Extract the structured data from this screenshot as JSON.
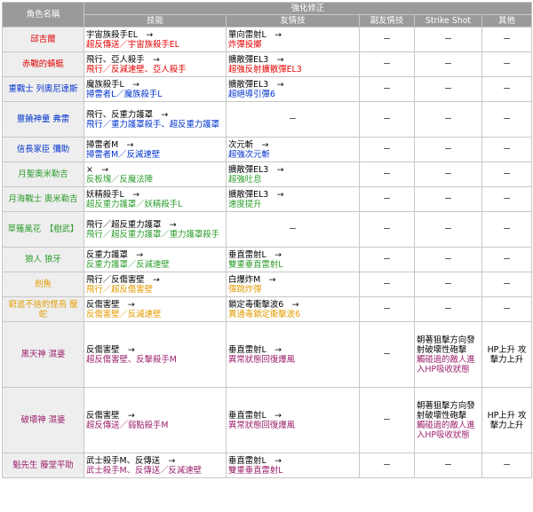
{
  "headers": {
    "name": "角色名稱",
    "group": "強化修正",
    "skill": "技能",
    "friend": "友情技",
    "subfriend": "副友情技",
    "ss": "Strike Shot",
    "other": "其他"
  },
  "dash": "－",
  "colors": {
    "red": "#e30000",
    "blue": "#0033cc",
    "green": "#2b9b2b",
    "orange": "#e39c00",
    "purple": "#9a1f6b"
  },
  "rows": [
    {
      "name": "邱吉爾",
      "skill": [
        "宇宙族殺手EL　→",
        "超反傳送／宇宙族殺手EL"
      ],
      "friend": [
        "單向雷射L　→",
        "炸彈投擲"
      ]
    },
    {
      "name": "赤戰的蜻蜓",
      "skill": [
        "飛行、亞人殺手　→",
        "飛行／反減速壁、亞人殺手"
      ],
      "friend": [
        "擴散彈EL3　→",
        "超強反射擴散彈EL3"
      ]
    },
    {
      "name": "重戰士 列奧尼達斯",
      "skill": [
        "魔族殺手L　→",
        "掃雷者L／魔族殺手L"
      ],
      "friend": [
        "擴散彈EL3　→",
        "超絕導引彈6"
      ]
    },
    {
      "name": "豐饒神童 弗雷",
      "skill": [
        "飛行、反重力護罩　→",
        "飛行／重力護罩殺手、超反重力護罩"
      ]
    },
    {
      "name": "信長家臣 彌助",
      "skill": [
        "掃雷者M　→",
        "掃雷者M／反減速壁"
      ],
      "friend": [
        "次元斬　→",
        "超強次元斬"
      ]
    },
    {
      "name": "月聖奧米勒吉",
      "skill": [
        "×　→",
        "反板塊／反魔法陣"
      ],
      "friend": [
        "擴散彈EL3　→",
        "超強吐息"
      ]
    },
    {
      "name": "月海戰士 奧米勒吉",
      "skill": [
        "妖精殺手L　→",
        "超反重力護罩／妖精殺手L"
      ],
      "friend": [
        "擴散彈EL3　→",
        "速度提升"
      ]
    },
    {
      "name": "草薙風花　【樹武】",
      "skill": [
        "飛行／超反重力護罩　→",
        "飛行／超反重力護罩／重力護罩殺手"
      ]
    },
    {
      "name": "狼人 狼牙",
      "skill": [
        "反重力護罩　→",
        "反重力護罩／反減速壁"
      ],
      "friend": [
        "垂直雷射L　→",
        "雙重垂直雷射L"
      ]
    },
    {
      "name": "劍魚",
      "skill": [
        "飛行／反傷害壁　→",
        "飛行／超反傷害壁"
      ],
      "friend": [
        "白爆炸M　→",
        "彈跳炸彈"
      ]
    },
    {
      "name": "窮追不捨的怪鳥 寵蛇",
      "skill": [
        "反傷害壁　→",
        "反傷害壁／反減速壁"
      ],
      "friend": [
        "鎖定毒衝擊波6　→",
        "貫通毒鎖定衝擊波6"
      ]
    },
    {
      "name": "黑天神 濕婆",
      "skill": [
        "反傷害壁　→",
        "超反傷害壁、反擊殺手M"
      ],
      "friend": [
        "垂直雷射L　→",
        "異常狀態回復爆風"
      ],
      "ss": [
        "朝著狙擊方向發射破壞性砲擊",
        "觸碰過的敵人進入HP吸收狀態"
      ],
      "other": "HP上升 攻擊力上升"
    },
    {
      "name": "破壞神 濕婆",
      "skill": [
        "反傷害壁　→",
        "超反傳送／弱點殺手M"
      ],
      "friend": [
        "垂直雷射L　→",
        "異常狀態回復爆風"
      ],
      "ss": [
        "朝著狙擊方向發射破壞性砲擊",
        "觸碰過的敵人進入HP吸收狀態"
      ],
      "other": "HP上升 攻擊力上升"
    },
    {
      "name": "魁先生 藤堂平助",
      "skill": [
        "武士殺手M、反傳送　→",
        "武士殺手M、反傳送／反減速壁"
      ],
      "friend": [
        "垂直雷射L　→",
        "雙重垂直雷射L"
      ]
    }
  ]
}
